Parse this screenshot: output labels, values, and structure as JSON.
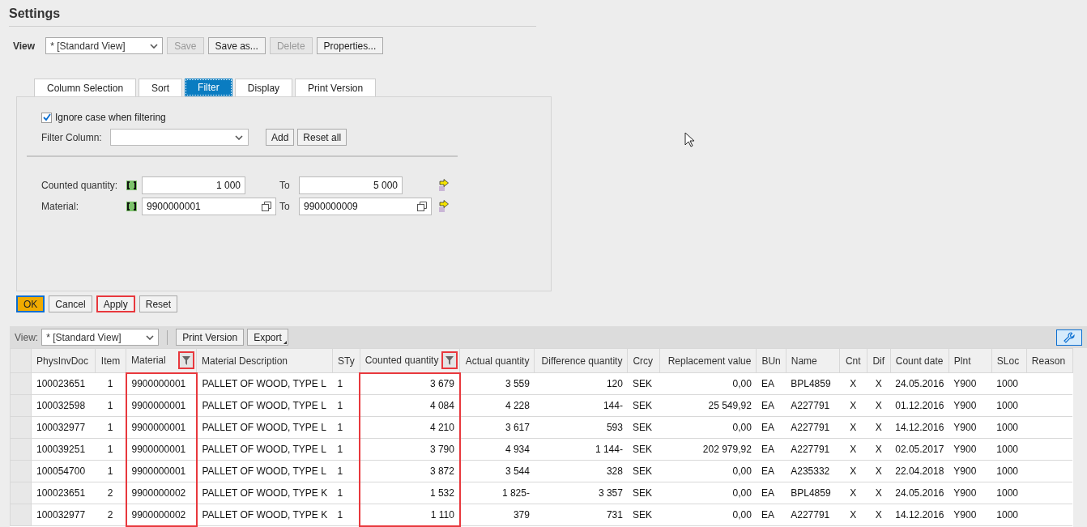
{
  "title": "Settings",
  "view_bar": {
    "label": "View",
    "value": "* [Standard View]",
    "buttons": [
      {
        "label": "Save",
        "disabled": true
      },
      {
        "label": "Save as...",
        "disabled": false
      },
      {
        "label": "Delete",
        "disabled": true
      },
      {
        "label": "Properties...",
        "disabled": false
      }
    ]
  },
  "tabs": [
    {
      "label": "Column Selection",
      "selected": false
    },
    {
      "label": "Sort",
      "selected": false
    },
    {
      "label": "Filter",
      "selected": true
    },
    {
      "label": "Display",
      "selected": false
    },
    {
      "label": "Print Version",
      "selected": false
    }
  ],
  "filter": {
    "ignore_case": {
      "label": "Ignore case when filtering",
      "checked": true
    },
    "column_label": "Filter Column:",
    "add": "Add",
    "reset_all": "Reset all",
    "conditions": [
      {
        "label": "Counted quantity:",
        "from": "1 000",
        "to_label": "To",
        "to": "5 000",
        "kind": "number"
      },
      {
        "label": "Material:",
        "from": "9900000001",
        "to_label": "To",
        "to": "9900000009",
        "kind": "lookup"
      }
    ]
  },
  "dialog_buttons": [
    {
      "label": "OK",
      "kind": "primary",
      "highlighted": false
    },
    {
      "label": "Cancel",
      "kind": "normal",
      "highlighted": false
    },
    {
      "label": "Apply",
      "kind": "normal",
      "highlighted": true
    },
    {
      "label": "Reset",
      "kind": "normal",
      "highlighted": false
    }
  ],
  "toolbar": {
    "view_label": "View:",
    "view_value": "* [Standard View]",
    "print": "Print Version",
    "export": "Export"
  },
  "table": {
    "columns": [
      {
        "label": "PhysInvDoc",
        "filtered": false
      },
      {
        "label": "Item",
        "filtered": false
      },
      {
        "label": "Material",
        "filtered": true
      },
      {
        "label": "Material Description",
        "filtered": false
      },
      {
        "label": "STy",
        "filtered": false
      },
      {
        "label": "Counted quantity",
        "filtered": true
      },
      {
        "label": "Actual quantity",
        "filtered": false
      },
      {
        "label": "Difference quantity",
        "filtered": false
      },
      {
        "label": "Crcy",
        "filtered": false
      },
      {
        "label": "Replacement value",
        "filtered": false
      },
      {
        "label": "BUn",
        "filtered": false
      },
      {
        "label": "Name",
        "filtered": false
      },
      {
        "label": "Cnt",
        "filtered": false
      },
      {
        "label": "Dif",
        "filtered": false
      },
      {
        "label": "Count date",
        "filtered": false
      },
      {
        "label": "Plnt",
        "filtered": false
      },
      {
        "label": "SLoc",
        "filtered": false
      },
      {
        "label": "Reason",
        "filtered": false
      }
    ],
    "rows": [
      [
        "100023651",
        "1",
        "9900000001",
        "PALLET OF WOOD, TYPE L",
        "1",
        "3 679",
        "3 559",
        "120",
        "SEK",
        "0,00",
        "EA",
        "BPL4859",
        "X",
        "X",
        "24.05.2016",
        "Y900",
        "1000",
        ""
      ],
      [
        "100032598",
        "1",
        "9900000001",
        "PALLET OF WOOD, TYPE L",
        "1",
        "4 084",
        "4 228",
        "144-",
        "SEK",
        "25 549,92",
        "EA",
        "A227791",
        "X",
        "X",
        "01.12.2016",
        "Y900",
        "1000",
        ""
      ],
      [
        "100032977",
        "1",
        "9900000001",
        "PALLET OF WOOD, TYPE L",
        "1",
        "4 210",
        "3 617",
        "593",
        "SEK",
        "0,00",
        "EA",
        "A227791",
        "X",
        "X",
        "14.12.2016",
        "Y900",
        "1000",
        ""
      ],
      [
        "100039251",
        "1",
        "9900000001",
        "PALLET OF WOOD, TYPE L",
        "1",
        "3 790",
        "4 934",
        "1 144-",
        "SEK",
        "202 979,92",
        "EA",
        "A227791",
        "X",
        "X",
        "02.05.2017",
        "Y900",
        "1000",
        ""
      ],
      [
        "100054700",
        "1",
        "9900000001",
        "PALLET OF WOOD, TYPE L",
        "1",
        "3 872",
        "3 544",
        "328",
        "SEK",
        "0,00",
        "EA",
        "A235332",
        "X",
        "X",
        "22.04.2018",
        "Y900",
        "1000",
        ""
      ],
      [
        "100023651",
        "2",
        "9900000002",
        "PALLET OF WOOD, TYPE K",
        "1",
        "1 532",
        "1 825-",
        "3 357",
        "SEK",
        "0,00",
        "EA",
        "BPL4859",
        "X",
        "X",
        "24.05.2016",
        "Y900",
        "1000",
        ""
      ],
      [
        "100032977",
        "2",
        "9900000002",
        "PALLET OF WOOD, TYPE K",
        "1",
        "1 110",
        "379",
        "731",
        "SEK",
        "0,00",
        "EA",
        "A227791",
        "X",
        "X",
        "14.12.2016",
        "Y900",
        "1000",
        ""
      ]
    ]
  }
}
